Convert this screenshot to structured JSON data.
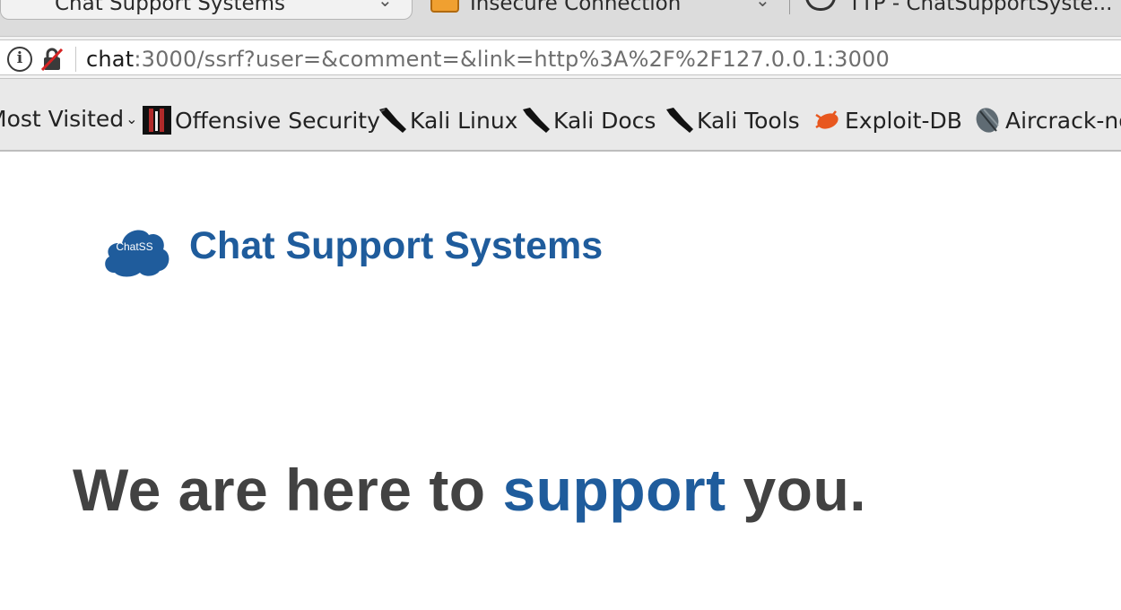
{
  "browser": {
    "tabs": [
      {
        "title": "Chat Support Systems",
        "active": true
      },
      {
        "title": "Insecure Connection",
        "active": false
      },
      {
        "title": "TTP - ChatSupportSyste...",
        "active": false
      }
    ],
    "address_bar": {
      "host": "chat",
      "rest": ":3000/ssrf?user=&comment=&link=http%3A%2F%2F127.0.0.1:3000"
    },
    "bookmarks": [
      {
        "label": "Most Visited",
        "icon": "chevron-down-icon"
      },
      {
        "label": "Offensive Security",
        "icon": "offsec-icon"
      },
      {
        "label": "Kali Linux",
        "icon": "kali-dragon-icon"
      },
      {
        "label": "Kali Docs",
        "icon": "kali-dragon-icon"
      },
      {
        "label": "Kali Tools",
        "icon": "kali-dragon-icon"
      },
      {
        "label": "Exploit-DB",
        "icon": "exploitdb-bug-icon"
      },
      {
        "label": "Aircrack-ng",
        "icon": "aircrack-icon"
      }
    ]
  },
  "page": {
    "logo_text": "ChatSS",
    "brand": "Chat Support Systems",
    "hero": {
      "before": "We are here to ",
      "highlight": "support",
      "after": " you."
    }
  },
  "colors": {
    "brand_blue": "#1f5c9c",
    "hero_gray": "#424242"
  }
}
